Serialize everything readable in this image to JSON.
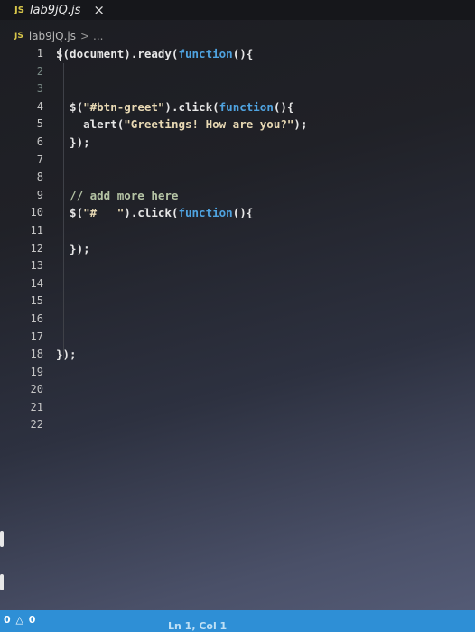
{
  "tab": {
    "badge": "JS",
    "name": "lab9jQ.js",
    "close": "×"
  },
  "breadcrumb": {
    "badge": "JS",
    "file": "lab9jQ.js",
    "sep": ">",
    "more": "..."
  },
  "editor": {
    "lines": [
      {
        "n": "1",
        "parts": [
          {
            "t": "$(document).ready(",
            "c": "pl"
          },
          {
            "t": "function",
            "c": "fn"
          },
          {
            "t": "(){",
            "c": "pl"
          }
        ]
      },
      {
        "n": "2",
        "parts": []
      },
      {
        "n": "3",
        "parts": []
      },
      {
        "n": "4",
        "parts": [
          {
            "t": "  $(",
            "c": "pl"
          },
          {
            "t": "\"#btn-greet\"",
            "c": "str"
          },
          {
            "t": ").click(",
            "c": "pl"
          },
          {
            "t": "function",
            "c": "fn"
          },
          {
            "t": "(){",
            "c": "pl"
          }
        ]
      },
      {
        "n": "5",
        "parts": [
          {
            "t": "    alert(",
            "c": "pl"
          },
          {
            "t": "\"Greetings! How are you?\"",
            "c": "str"
          },
          {
            "t": ");",
            "c": "pl"
          }
        ]
      },
      {
        "n": "6",
        "parts": [
          {
            "t": "  });",
            "c": "pl"
          }
        ]
      },
      {
        "n": "7",
        "parts": []
      },
      {
        "n": "8",
        "parts": []
      },
      {
        "n": "9",
        "parts": [
          {
            "t": "  // add more here",
            "c": "cm"
          }
        ]
      },
      {
        "n": "10",
        "parts": [
          {
            "t": "  $(",
            "c": "pl"
          },
          {
            "t": "\"#   \"",
            "c": "str"
          },
          {
            "t": ").click(",
            "c": "pl"
          },
          {
            "t": "function",
            "c": "fn"
          },
          {
            "t": "(){",
            "c": "pl"
          }
        ]
      },
      {
        "n": "11",
        "parts": []
      },
      {
        "n": "12",
        "parts": [
          {
            "t": "  });",
            "c": "pl"
          }
        ]
      },
      {
        "n": "13",
        "parts": []
      },
      {
        "n": "14",
        "parts": []
      },
      {
        "n": "15",
        "parts": []
      },
      {
        "n": "16",
        "parts": []
      },
      {
        "n": "17",
        "parts": []
      },
      {
        "n": "18",
        "parts": [
          {
            "t": "});",
            "c": "pl"
          }
        ]
      },
      {
        "n": "19",
        "parts": []
      },
      {
        "n": "20",
        "parts": []
      },
      {
        "n": "21",
        "parts": []
      },
      {
        "n": "22",
        "parts": []
      }
    ]
  },
  "status": {
    "left": "0 △ 0",
    "right": "Ln 1, Col 1"
  }
}
